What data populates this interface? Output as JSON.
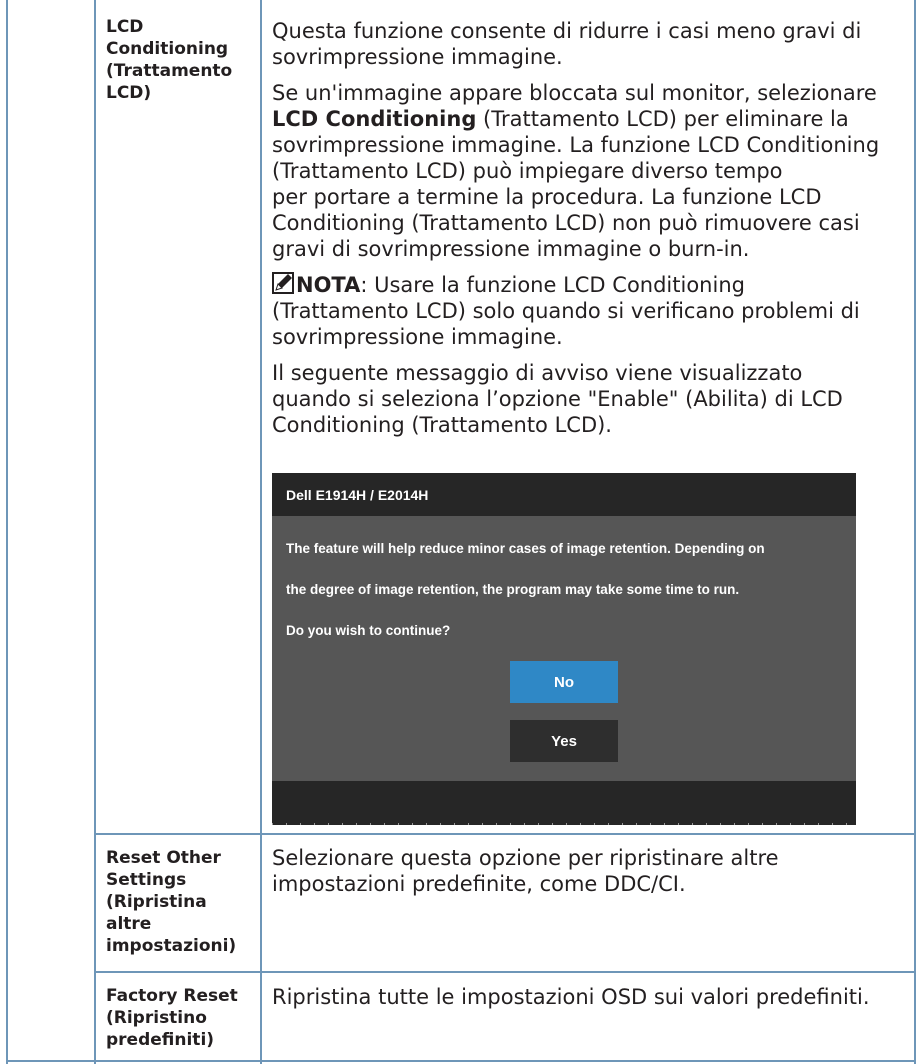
{
  "rows": [
    {
      "label": "LCD\nConditioning\n(Trattamento\nLCD)",
      "paragraphs": {
        "p1": "Questa funzione consente di ridurre i casi meno gravi di\nsovrimpressione immagine.",
        "p2_before": "Se un'immagine appare bloccata sul monitor, selezionare\n",
        "p2_bold": "LCD Conditioning",
        "p2_after": " (Trattamento LCD) per eliminare la\nsovrimpressione immagine. La funzione LCD Conditioning\n(Trattamento LCD) può impiegare diverso tempo\nper portare a termine la procedura. La funzione LCD\nConditioning (Trattamento LCD) non può rimuovere casi\ngravi di sovrimpressione immagine o burn-in.",
        "note_label": "NOTA",
        "note_text": ": Usare la funzione LCD Conditioning\n(Trattamento LCD) solo quando si verificano problemi di\nsovrimpressione immagine.",
        "p4": "Il seguente messaggio di avviso viene visualizzato\nquando si seleziona l’opzione \"Enable\" (Abilita) di LCD\nConditioning (Trattamento LCD)."
      },
      "note_icon": "pencil-note-icon"
    },
    {
      "label": "Reset Other\nSettings\n(Ripristina\naltre\nimpostazioni)",
      "text": "Selezionare questa opzione per ripristinare altre\nimpostazioni predefinite, come DDC/CI."
    },
    {
      "label": "Factory Reset\n(Ripristino\npredefiniti)",
      "text": "Ripristina tutte le impostazioni OSD sui valori predefiniti."
    }
  ],
  "osd": {
    "title": "Dell E1914H / E2014H",
    "line1": "The feature will help reduce minor cases of image retention. Depending on",
    "line2": "the degree of image retention, the program may take some time to run.",
    "line3": "Do you wish to continue?",
    "no_label": "No",
    "yes_label": "Yes",
    "colors": {
      "title_bar": "#262626",
      "body": "#565656",
      "no_button": "#2f88c6",
      "yes_button": "#2e2e2e"
    }
  },
  "colors": {
    "table_border": "#6e96b8",
    "text": "#231f20"
  }
}
